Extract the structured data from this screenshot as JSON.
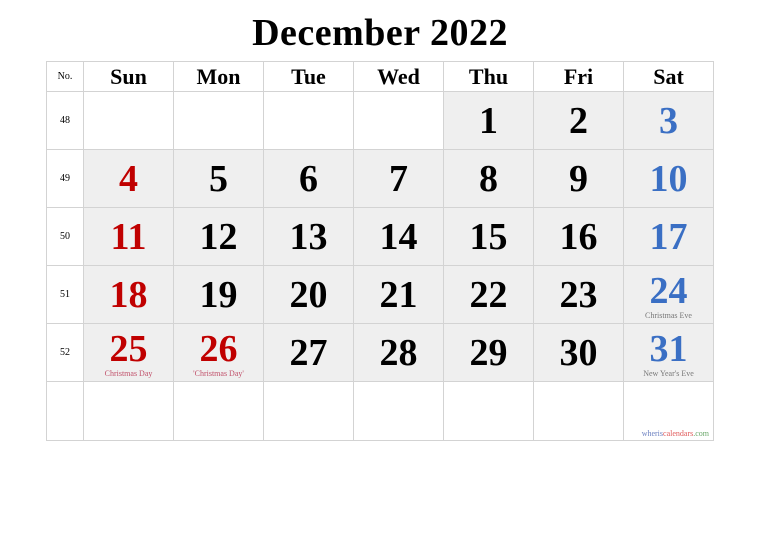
{
  "title": "December 2022",
  "header": {
    "week_label": "No.",
    "days": [
      "Sun",
      "Mon",
      "Tue",
      "Wed",
      "Thu",
      "Fri",
      "Sat"
    ]
  },
  "colors": {
    "sunday_holiday": "#c00000",
    "saturday": "#3a6fc4",
    "weekday": "#000000",
    "cell_fill": "#efefef",
    "grid": "#d3d3d3"
  },
  "weeks": [
    {
      "number": "48",
      "days": [
        "",
        "",
        "",
        "",
        "1",
        "2",
        "3"
      ]
    },
    {
      "number": "49",
      "days": [
        "4",
        "5",
        "6",
        "7",
        "8",
        "9",
        "10"
      ]
    },
    {
      "number": "50",
      "days": [
        "11",
        "12",
        "13",
        "14",
        "15",
        "16",
        "17"
      ]
    },
    {
      "number": "51",
      "days": [
        "18",
        "19",
        "20",
        "21",
        "22",
        "23",
        "24"
      ]
    },
    {
      "number": "52",
      "days": [
        "25",
        "26",
        "27",
        "28",
        "29",
        "30",
        "31"
      ]
    },
    {
      "number": "",
      "days": [
        "",
        "",
        "",
        "",
        "",
        "",
        ""
      ]
    }
  ],
  "notes": {
    "24": "Christmas Eve",
    "25": "Christmas Day",
    "26": "'Christmas Day'",
    "31": "New Year's Eve"
  },
  "holidays": [
    "25",
    "26"
  ],
  "watermark": {
    "part1": "wheris",
    "part2": "calendars",
    "part3": ".com"
  }
}
